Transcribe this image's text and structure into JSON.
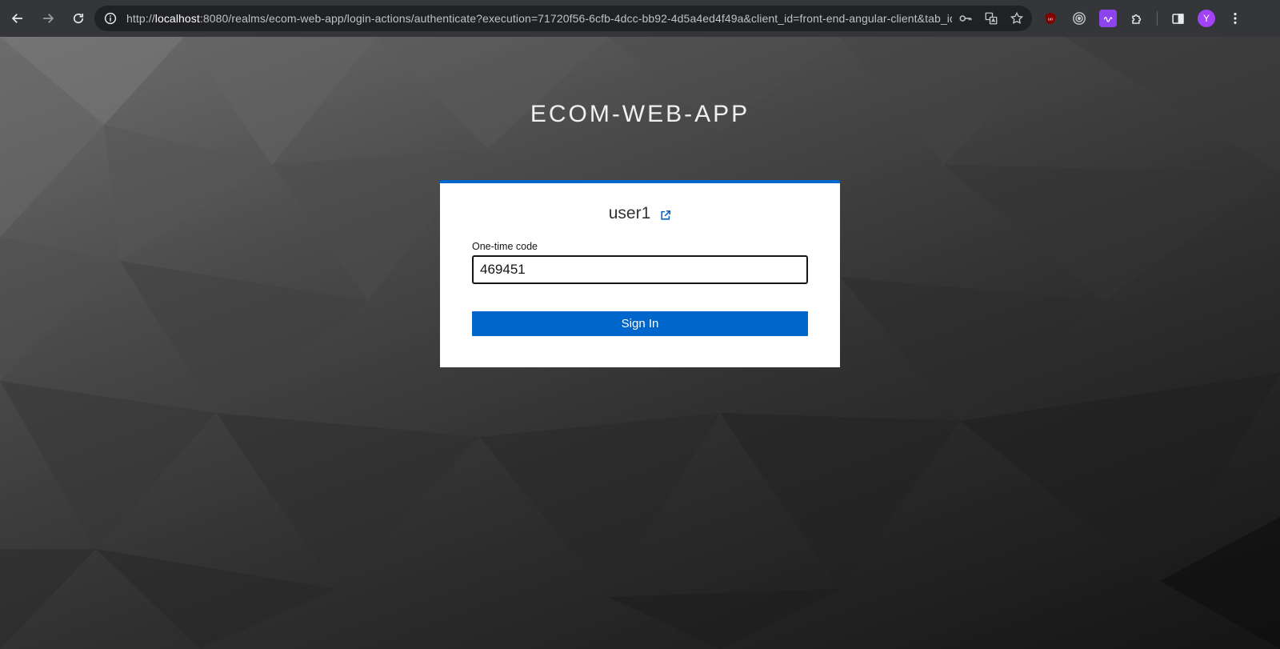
{
  "browser": {
    "url_prefix": "http://",
    "url_host": "localhost",
    "url_rest": ":8080/realms/ecom-web-app/login-actions/authenticate?execution=71720f56-6cfb-4dcc-bb92-4d5a4ed4f49a&client_id=front-end-angular-client&tab_id...",
    "profile_initial": "Y"
  },
  "realm": {
    "title": "ECOM-WEB-APP"
  },
  "login": {
    "username": "user1",
    "otp_label": "One-time code",
    "otp_value": "469451",
    "signin_label": "Sign In"
  },
  "colors": {
    "accent": "#0066cc",
    "browser_bar": "#35363a"
  }
}
